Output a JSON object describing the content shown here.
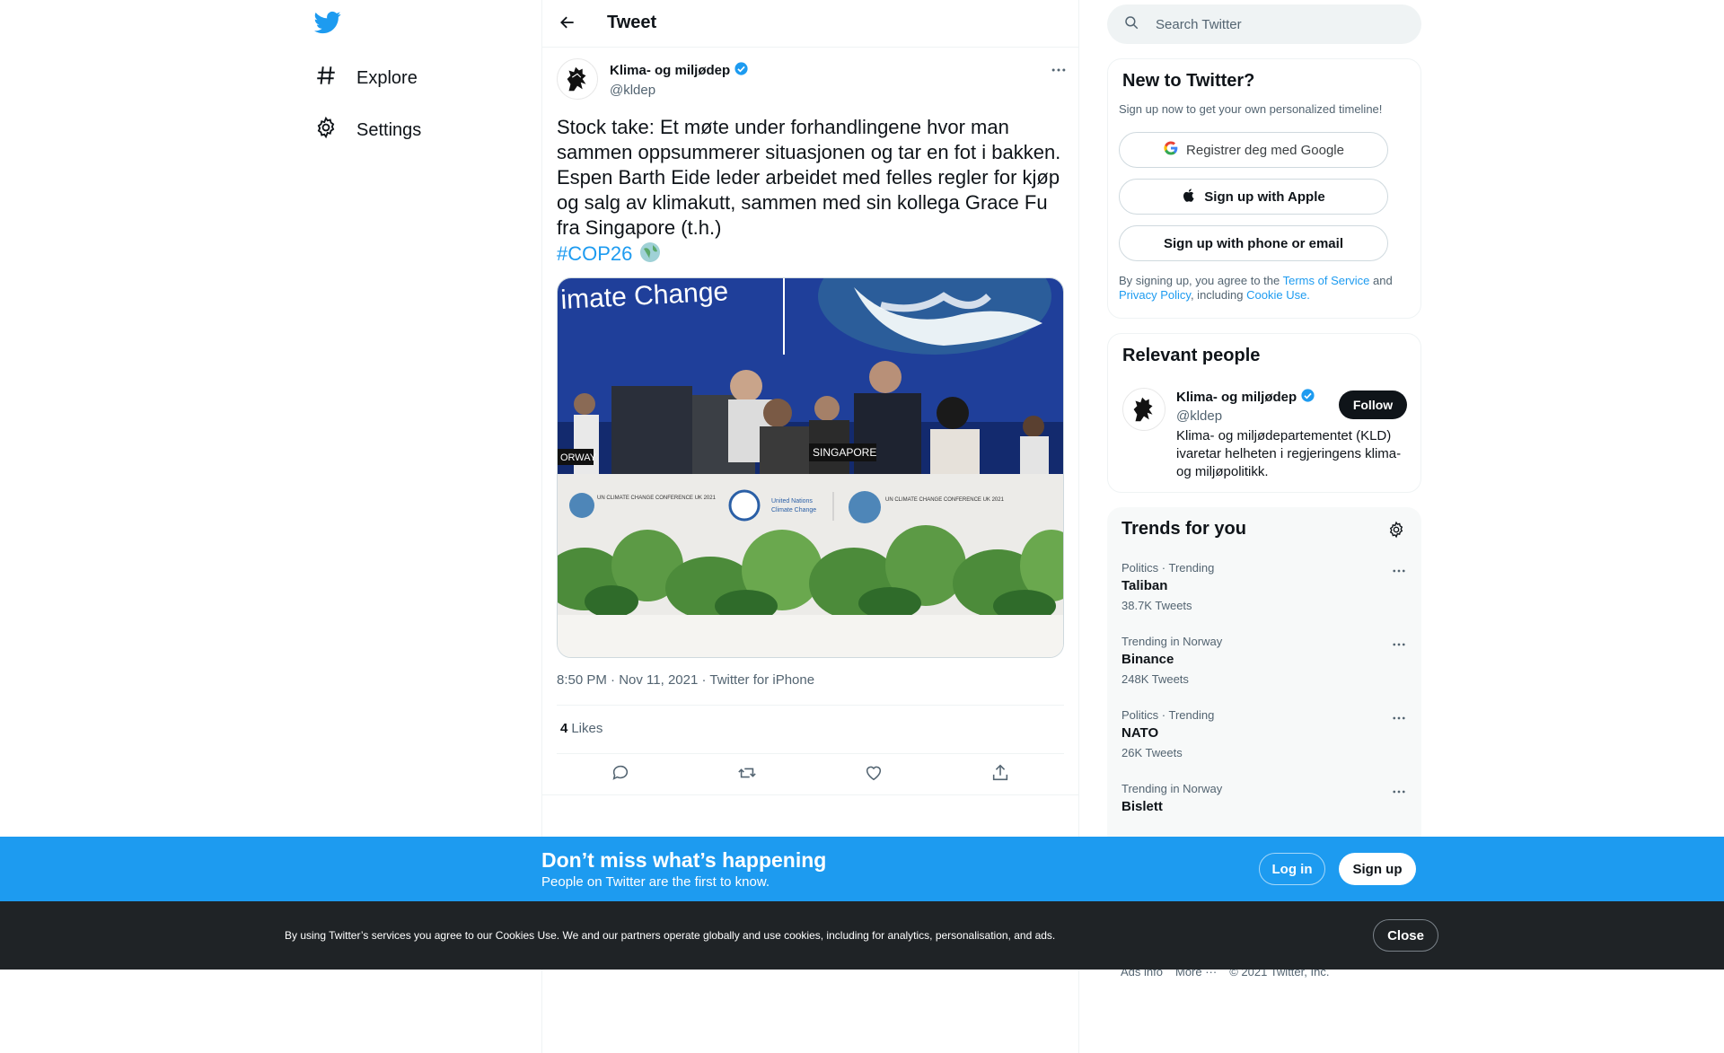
{
  "nav": {
    "logo_icon": "twitter-bird-icon",
    "items": [
      {
        "label": "Explore",
        "icon": "hashtag-icon"
      },
      {
        "label": "Settings",
        "icon": "gear-icon"
      }
    ]
  },
  "header": {
    "title": "Tweet",
    "back_icon": "arrow-left-icon"
  },
  "tweet": {
    "author_name": "Klima- og miljødep",
    "author_handle": "@kldep",
    "verified": true,
    "text": "Stock take: Et møte under forhandlingene hvor man sammen oppsummerer situasjonen og tar en fot i bakken. Espen Barth Eide leder arbeidet med felles regler for kjøp og salg av klimakutt, sammen med sin kollega Grace Fu fra Singapore (t.h.)",
    "hashtag": "#COP26",
    "media": {
      "banner_text": "imate Change",
      "nameplate_left": "ORWAY",
      "nameplate_center": "SINGAPORE",
      "logo_left": "UN CLIMATE CHANGE CONFERENCE UK 2021",
      "logo_center_line1": "United Nations",
      "logo_center_line2": "Climate Change",
      "logo_right": "UN CLIMATE CHANGE CONFERENCE UK 2021"
    },
    "meta": "8:50 PM · Nov 11, 2021 · Twitter for iPhone",
    "likes_count": "4",
    "likes_label": "Likes"
  },
  "search": {
    "placeholder": "Search Twitter"
  },
  "new_to_twitter": {
    "title": "New to Twitter?",
    "subtitle": "Sign up now to get your own personalized timeline!",
    "google_label": "Registrer deg med Google",
    "apple_label": "Sign up with Apple",
    "phone_label": "Sign up with phone or email",
    "legal_prefix": "By signing up, you agree to the ",
    "tos": "Terms of Service",
    "and": " and ",
    "privacy": "Privacy Policy",
    "including": ", including ",
    "cookie": "Cookie Use."
  },
  "relevant": {
    "title": "Relevant people",
    "name": "Klima- og miljødep",
    "handle": "@kldep",
    "follow_label": "Follow",
    "bio": "Klima- og miljødepartementet (KLD) ivaretar helheten i regjeringens klima- og miljøpolitikk."
  },
  "trends": {
    "title": "Trends for you",
    "items": [
      {
        "context": "Politics · Trending",
        "name": "Taliban",
        "count": "38.7K Tweets"
      },
      {
        "context": "Trending in Norway",
        "name": "Binance",
        "count": "248K Tweets"
      },
      {
        "context": "Politics · Trending",
        "name": "NATO",
        "count": "26K Tweets"
      },
      {
        "context": "Trending in Norway",
        "name": "Bislett",
        "count": ""
      }
    ]
  },
  "footer": {
    "ads": "Ads info",
    "more": "More ···",
    "copyright": "© 2021 Twitter, Inc."
  },
  "signup_bar": {
    "title": "Don’t miss what’s happening",
    "subtitle": "People on Twitter are the first to know.",
    "login_label": "Log in",
    "signup_label": "Sign up"
  },
  "cookie_bar": {
    "text": "By using Twitter’s services you agree to our Cookies Use. We and our partners operate globally and use cookies, including for analytics, personalisation, and ads.",
    "close_label": "Close"
  },
  "colors": {
    "accent": "#1d9bf0",
    "text": "#0f1419",
    "muted": "#536471",
    "cookie_bg": "#1f2326"
  }
}
